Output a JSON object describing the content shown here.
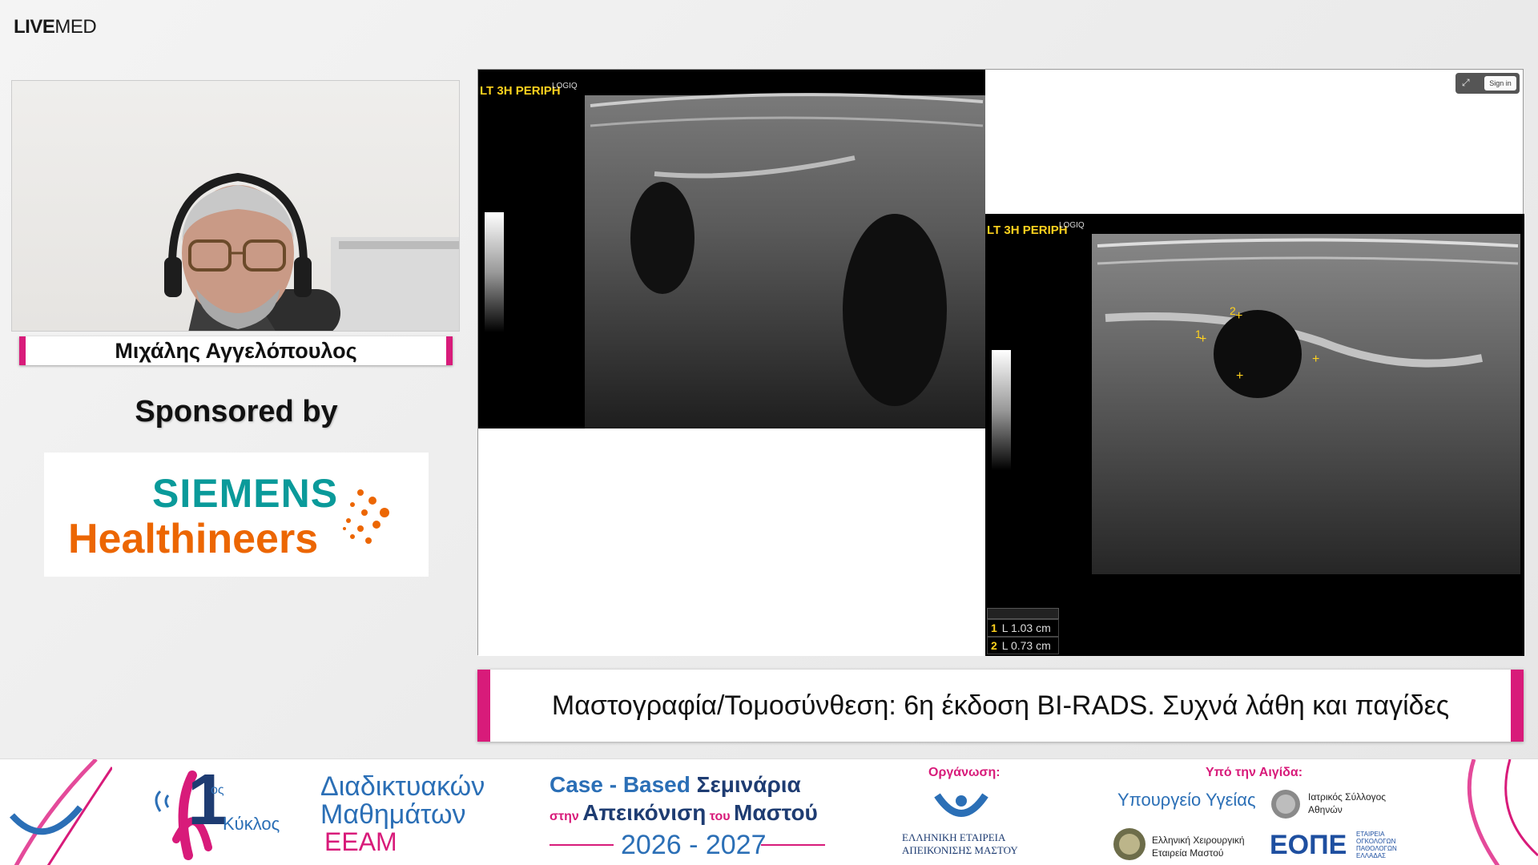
{
  "brand": {
    "part1": "LIVE",
    "part2": "MED"
  },
  "speaker": {
    "name": "Μιχάλης Αγγελόπουλος"
  },
  "sponsor": {
    "label": "Sponsored by",
    "logo_line1": "SIEMENS",
    "logo_line2": "Healthineers",
    "colors": {
      "teal": "#0a9a9a",
      "orange": "#ec6602"
    }
  },
  "screen": {
    "image1": {
      "label": "LT 3H PERIPH",
      "small": "LOGIQ"
    },
    "image2": {
      "label": "LT 3H PERIPH",
      "small": "LOGIQ",
      "markers": [
        "1",
        "2"
      ],
      "measurements": [
        {
          "n": "1",
          "text": "L  1.03 cm"
        },
        {
          "n": "2",
          "text": "L  0.73 cm"
        }
      ]
    },
    "signin": "Sign in"
  },
  "title": "Μαστογραφία/Τομοσύνθεση: 6η έκδοση BI-RADS.  Συχνά λάθη και παγίδες",
  "footer": {
    "cycle_num": "1",
    "cycle_sup": "ος",
    "cycle_word": "Κύκλος",
    "series_l1": "Διαδικτυακών",
    "series_l2": "Μαθημάτων",
    "series_l3": "ΕΕΑΜ",
    "cb_l1a": "Case - Based",
    "cb_l1b": "Σεμινάρια",
    "cb_l2a": "στην",
    "cb_l2b": "Απεικόνιση",
    "cb_l2c": "του",
    "cb_l2d": "Μαστού",
    "years": "2026 - 2027",
    "org_label": "Οργάνωση:",
    "org_l1": "ΕΛΛΗΝΙΚΗ ΕΤΑΙΡΕΙΑ",
    "org_l2": "ΑΠΕΙΚΟΝΙΣΗΣ ΜΑΣΤΟΥ",
    "aegis_label": "Υπό την Αιγίδα:",
    "ministry": "Υπουργείο Υγείας",
    "isa_l1": "Ιατρικός Σύλλογος",
    "isa_l2": "Αθηνών",
    "surg_l1": "Ελληνική Χειρουργική",
    "surg_l2": "Εταιρεία Μαστού",
    "eope": "ΕΟΠΕ",
    "eope_sub1": "ΕΤΑΙΡΕΙΑ",
    "eope_sub2": "ΟΓΚΟΛΟΓΩΝ",
    "eope_sub3": "ΠΑΘΟΛΟΓΩΝ",
    "eope_sub4": "ΕΛΛΑΔΑΣ"
  }
}
